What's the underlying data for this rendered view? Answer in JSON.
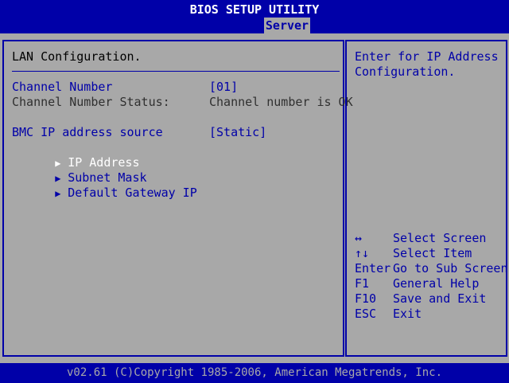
{
  "header": {
    "title": "BIOS SETUP UTILITY"
  },
  "tabs": [
    {
      "label": "Server",
      "active": true
    }
  ],
  "main": {
    "section_title": "LAN Configuration.",
    "fields": [
      {
        "label": "Channel Number",
        "value": "[01]"
      },
      {
        "label": "Channel Number Status:",
        "value": "Channel number is OK"
      },
      {
        "label": "BMC IP address source",
        "value": "[Static]"
      }
    ],
    "submenus": [
      {
        "label": "IP Address",
        "selected": true
      },
      {
        "label": "Subnet Mask",
        "selected": false
      },
      {
        "label": "Default Gateway IP",
        "selected": false
      }
    ],
    "submenu_arrow": "▶"
  },
  "help": {
    "description": "Enter for IP Address Configuration.",
    "keys": [
      {
        "key": "↔",
        "action": "Select Screen"
      },
      {
        "key": "↑↓",
        "action": "Select Item"
      },
      {
        "key": "Enter",
        "action": "Go to Sub Screen"
      },
      {
        "key": "F1",
        "action": "General Help"
      },
      {
        "key": "F10",
        "action": "Save and Exit"
      },
      {
        "key": "ESC",
        "action": "Exit"
      }
    ]
  },
  "footer": {
    "copyright": "v02.61 (C)Copyright 1985-2006, American Megatrends, Inc."
  },
  "colors": {
    "background_blue": "#0000a8",
    "panel_gray": "#a8a8a8",
    "text_white": "#ffffff"
  }
}
